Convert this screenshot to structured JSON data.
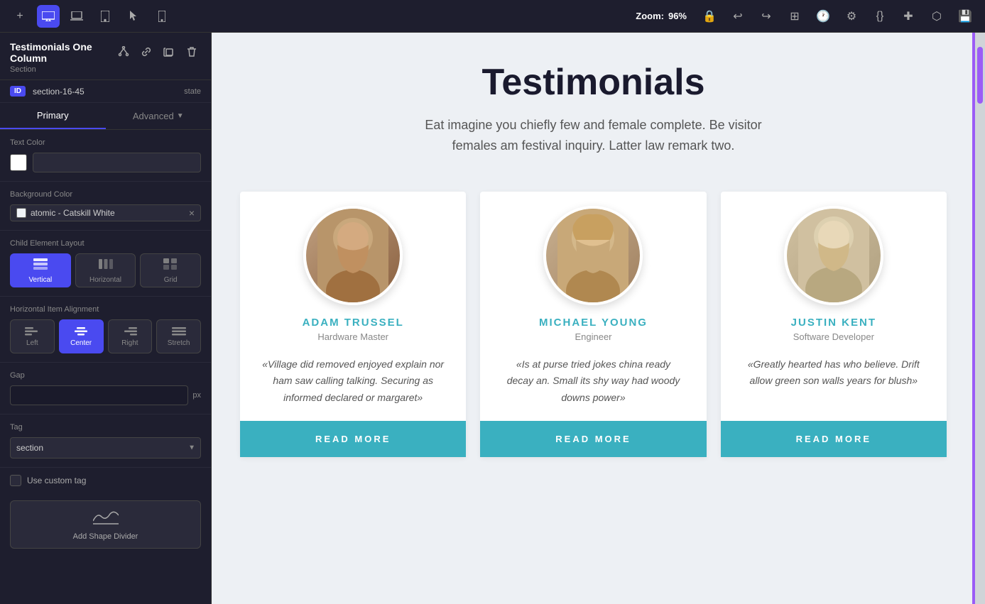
{
  "toolbar": {
    "zoom_label": "Zoom:",
    "zoom_value": "96%",
    "icons": [
      "plus",
      "desktop",
      "laptop",
      "tablet",
      "pointer",
      "mobile"
    ]
  },
  "sidebar": {
    "title": "Testimonials One Column",
    "subtitle": "Section",
    "id_badge": "ID",
    "section_id": "section-16-45",
    "state_label": "state",
    "tabs": {
      "primary": "Primary",
      "advanced": "Advanced"
    },
    "text_color_label": "Text Color",
    "background_color_label": "Background Color",
    "bg_color_value": "atomic - Catskill White",
    "child_layout_label": "Child Element Layout",
    "layout_options": [
      "Vertical",
      "Horizontal",
      "Grid"
    ],
    "alignment_label": "Horizontal Item Alignment",
    "alignment_options": [
      "Left",
      "Center",
      "Right",
      "Stretch"
    ],
    "gap_label": "Gap",
    "gap_placeholder": "",
    "gap_unit": "px",
    "tag_label": "Tag",
    "tag_value": "section",
    "custom_tag_label": "Use custom tag",
    "add_shape_label": "Add Shape\nDivider"
  },
  "canvas": {
    "title": "Testimonials",
    "subtitle": "Eat imagine you chiefly few and female complete. Be visitor females am festival inquiry. Latter law remark two.",
    "testimonials": [
      {
        "name": "ADAM TRUSSEL",
        "role": "Hardware Master",
        "quote": "«Village did removed enjoyed explain nor ham saw calling talking. Securing as informed declared or margaret»",
        "btn": "READ MORE"
      },
      {
        "name": "MICHAEL YOUNG",
        "role": "Engineer",
        "quote": "«Is at purse tried jokes china ready decay an. Small its shy way had woody downs power»",
        "btn": "READ MORE"
      },
      {
        "name": "JUSTIN KENT",
        "role": "Software Developer",
        "quote": "«Greatly hearted has who believe. Drift allow green son walls years for blush»",
        "btn": "READ MORE"
      }
    ]
  }
}
